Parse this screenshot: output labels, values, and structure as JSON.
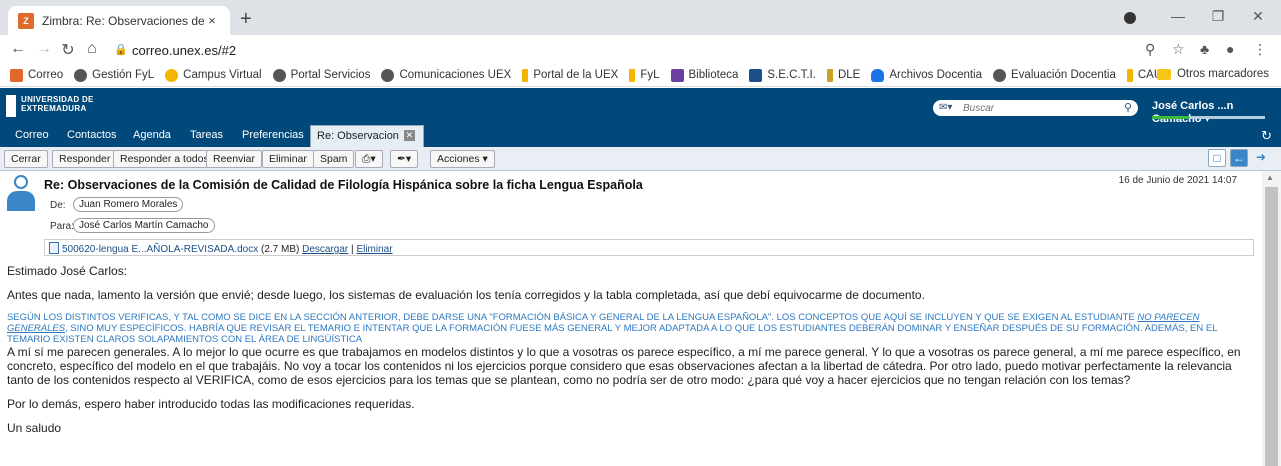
{
  "browser": {
    "tab_title": "Zimbra: Re: Observaciones de la",
    "tab_close": "×",
    "new_tab": "+",
    "url": "correo.unex.es/#2",
    "bookmarks": [
      {
        "label": "Correo",
        "color": "#e06a2c"
      },
      {
        "label": "Gestión FyL",
        "color": "#555555"
      },
      {
        "label": "Campus Virtual",
        "color": "#f4b400"
      },
      {
        "label": "Portal Servicios",
        "color": "#555555"
      },
      {
        "label": "Comunicaciones UEX",
        "color": "#555555"
      },
      {
        "label": "Portal de la UEX",
        "color": "#f4b400"
      },
      {
        "label": "FyL",
        "color": "#f4b400"
      },
      {
        "label": "Biblioteca",
        "color": "#6b3fa0"
      },
      {
        "label": "S.E.C.T.I.",
        "color": "#1a4f8a"
      },
      {
        "label": "DLE",
        "color": "#c9a227"
      },
      {
        "label": "Archivos Docentia",
        "color": "#1a73e8"
      },
      {
        "label": "Evaluación Docentia",
        "color": "#555555"
      },
      {
        "label": "CAU",
        "color": "#f4b400"
      }
    ],
    "other_bookmarks": "Otros marcadores"
  },
  "zimbra": {
    "logo_line1": "UNIVERSIDAD DE",
    "logo_line2": "EXTREMADURA",
    "search_placeholder": "Buscar",
    "user_name": "José Carlos ...n Camacho",
    "app_tabs": [
      "Correo",
      "Contactos",
      "Agenda",
      "Tareas",
      "Preferencias"
    ],
    "active_tab": "Re: Observacion",
    "toolbar": {
      "close": "Cerrar",
      "reply": "Responder",
      "reply_all": "Responder a todos",
      "forward": "Reenviar",
      "delete": "Eliminar",
      "spam": "Spam",
      "actions": "Acciones"
    }
  },
  "message": {
    "subject": "Re: Observaciones de la Comisión de Calidad de Filología Hispánica sobre la ficha Lengua Española",
    "date": "16 de Junio de 2021 14:07",
    "from_label": "De:",
    "from": "Juan Romero Morales",
    "to_label": "Para:",
    "to": "José Carlos Martín Camacho",
    "attachment_name": "500620-lengua E...AÑOLA-REVISADA.docx",
    "attachment_size": "(2.7 MB)",
    "attachment_download": "Descargar",
    "attachment_sep": "|",
    "attachment_delete": "Eliminar",
    "greeting": "Estimado José Carlos:",
    "para1": "Antes que nada, lamento la versión que envié; desde luego, los sistemas de evaluación los tenía corregidos y la tabla completada, así que debí equivocarme de documento.",
    "quote_part1": "SEGÚN LOS DISTINTOS VERIFICAS, Y TAL COMO SE DICE EN LA SECCIÓN ANTERIOR, DEBE DARSE UNA \"FORMACIÓN BÁSICA Y GENERAL DE LA LENGUA ESPAÑOLA\". LOS CONCEPTOS QUE AQUÍ SE INCLUYEN Y QUE SE EXIGEN AL ESTUDIANTE ",
    "quote_emph": "NO PARECEN GENERALES",
    "quote_part2": ", SINO MUY ESPECÍFICOS. HABRÍA QUE REVISAR EL TEMARIO E INTENTAR QUE LA FORMACIÓN FUESE MÁS GENERAL Y MEJOR ADAPTADA A LO QUE LOS ESTUDIANTES DEBERÁN DOMINAR Y ENSEÑAR DESPUÉS DE SU FORMACIÓN. ADEMÁS, EN EL TEMARIO EXISTEN CLAROS SOLAPAMIENTOS CON EL ÁREA DE LINGÜÍSTICA",
    "para2": "A mí sí me parecen generales. A lo mejor lo que ocurre es que trabajamos en modelos distintos y lo que a vosotras os parece específico, a mí me parece general. Y lo que a vosotras os parece general, a mí me parece específico, en concreto, específico del modelo en el que trabajáis.  No voy a tocar los contenidos ni los ejercicios porque considero que esas observaciones afectan a la libertad de cátedra. Por otro lado, puedo motivar perfectamente la relevancia tanto de los contenidos respecto al VERIFICA, como de esos ejercicios para los temas que se plantean, como no podría ser de otro modo: ¿para qué voy a hacer ejercicios que no tengan relación con los temas?",
    "para3": "Por lo demás, espero haber introducido todas las modificaciones requeridas.",
    "closing": "Un saludo"
  }
}
